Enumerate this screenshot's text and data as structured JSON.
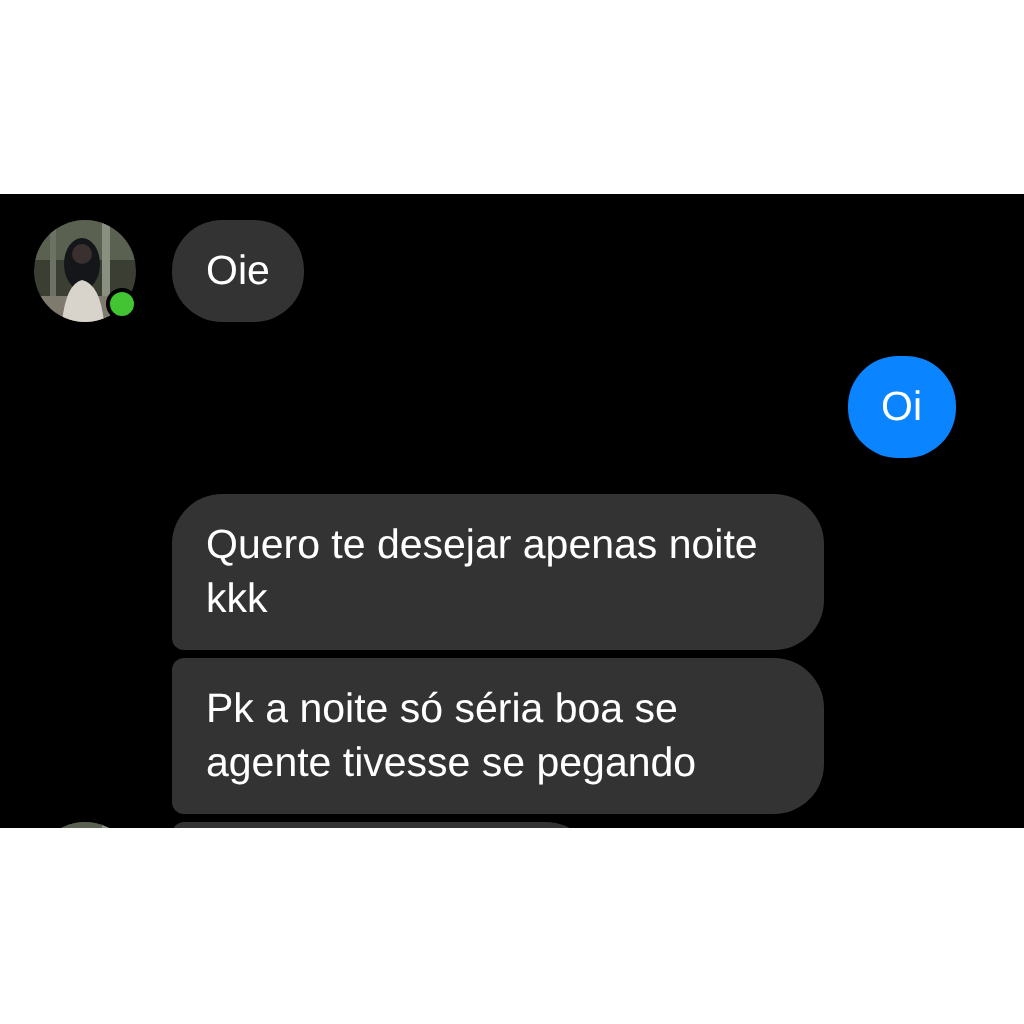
{
  "groups": [
    {
      "kind": "incoming",
      "avatar": true,
      "online": true,
      "messages": [
        {
          "text": "Oie"
        }
      ]
    },
    {
      "kind": "outgoing",
      "avatar": false,
      "messages": [
        {
          "text": "Oi"
        }
      ]
    },
    {
      "kind": "incoming",
      "avatar": true,
      "messages": [
        {
          "text": "Quero te desejar apenas noite kkk"
        },
        {
          "text": "Pk a noite só séria boa se agente tivesse se pegando"
        },
        {
          "clipped": true
        }
      ]
    }
  ]
}
